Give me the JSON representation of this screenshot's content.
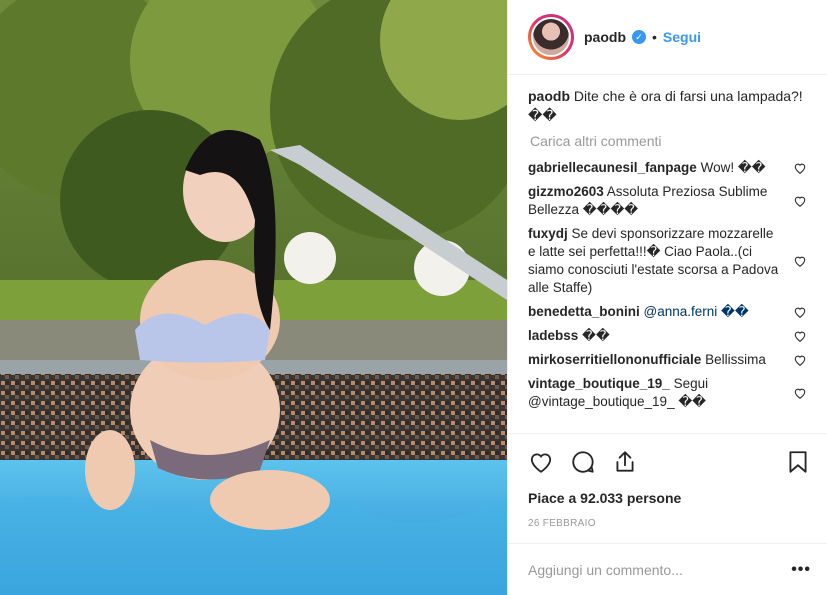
{
  "header": {
    "username": "paodb",
    "verified_icon": "verified-badge-icon",
    "follow_label": "Segui",
    "separator": "•"
  },
  "caption": {
    "username": "paodb",
    "text": "Dite che è ora di farsi una lampada?! ��"
  },
  "load_more_label": "Carica altri commenti",
  "comments": [
    {
      "username": "gabriellecaunesil_fanpage",
      "text": "Wow! ��"
    },
    {
      "username": "gizzmo2603",
      "text": "Assoluta Preziosa Sublime Bellezza ����"
    },
    {
      "username": "fuxydj",
      "text": "Se devi sponsorizzare mozzarelle e latte sei perfetta!!!� Ciao Paola..(ci siamo conosciuti l'estate scorsa a Padova alle Staffe)"
    },
    {
      "username": "benedetta_bonini",
      "text": "@anna.ferni ��"
    },
    {
      "username": "ladebss",
      "text": "��"
    },
    {
      "username": "mirkoserritiellononufficiale",
      "text": "Bellissima"
    },
    {
      "username": "vintage_boutique_19_",
      "text": "Segui @vintage_boutique_19_ ��"
    }
  ],
  "likes_text": "Piace a 92.033 persone",
  "date": "26 FEBBRAIO",
  "add_comment_placeholder": "Aggiungi un commento...",
  "more_options": "•••",
  "colors": {
    "accent": "#3897f0",
    "border": "#efefef",
    "muted": "#999999"
  }
}
